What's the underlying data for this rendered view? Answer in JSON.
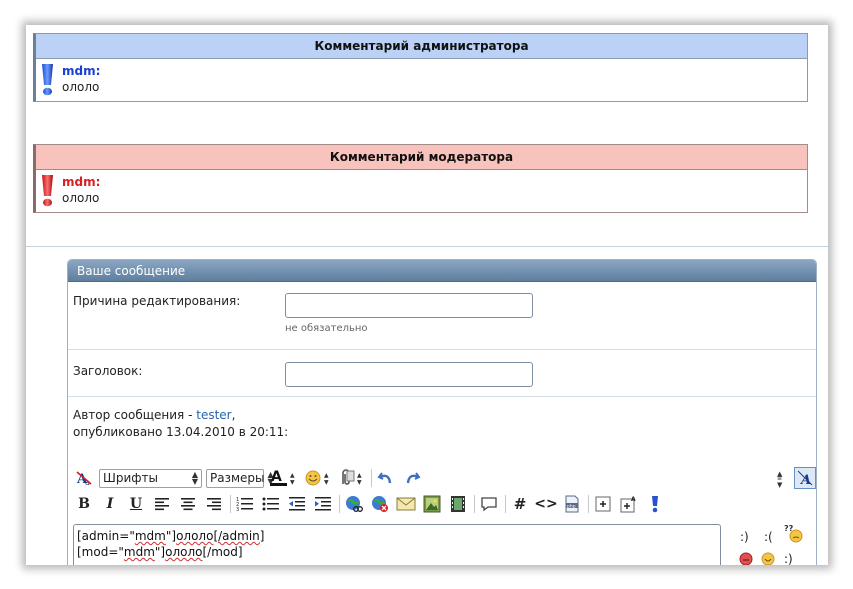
{
  "admin_comment": {
    "title": "Комментарий администратора",
    "author": "mdm:",
    "text": "ололо",
    "accent": "#1a3fd6"
  },
  "mod_comment": {
    "title": "Комментарий модератора",
    "author": "mdm:",
    "text": "ололо",
    "accent": "#d91f1f"
  },
  "form": {
    "panel_title": "Ваше сообщение",
    "reason_label": "Причина редактирования:",
    "reason_value": "",
    "reason_hint": "не обязательно",
    "title_label": "Заголовок:",
    "title_value": "",
    "author_prefix": "Автор сообщения - ",
    "author_name": "tester",
    "author_suffix": ",",
    "published": "опубликовано 13.04.2010 в 20:11:"
  },
  "toolbar": {
    "fonts_label": "Шрифты",
    "sizes_label": "Размеры",
    "row1_icons": [
      "remove-format-icon",
      "font-select",
      "size-select",
      "font-color-icon",
      "smiley-icon",
      "attach-icon",
      "undo-icon",
      "redo-icon"
    ],
    "row2_icons": [
      "bold-icon",
      "italic-icon",
      "underline-icon",
      "align-left-icon",
      "align-center-icon",
      "align-right-icon",
      "ordered-list-icon",
      "unordered-list-icon",
      "outdent-icon",
      "indent-icon",
      "insert-link-icon",
      "remove-link-icon",
      "email-icon",
      "image-icon",
      "video-icon",
      "quote-icon",
      "hash-icon",
      "code-icon",
      "php-icon",
      "expand-icon",
      "font-size-increase-icon",
      "exclamation-icon"
    ]
  },
  "editor": {
    "line1_a": "[admin=\"",
    "line1_b": "mdm",
    "line1_c": "\"]",
    "line1_d": "ололо",
    "line1_e": "[/admin]",
    "line2_a": "[mod=\"",
    "line2_b": "mdm",
    "line2_c": "\"]",
    "line2_d": "ололо",
    "line2_e": "[/mod]"
  },
  "smileys": {
    "happy": ":)",
    "sad": ":(",
    "wink": ":)"
  }
}
